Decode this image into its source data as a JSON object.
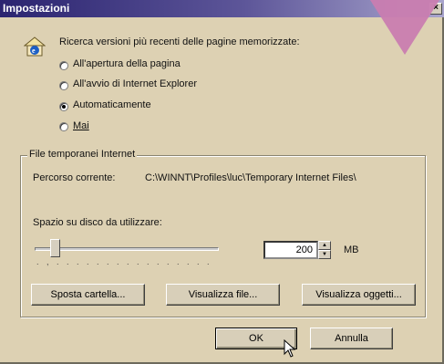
{
  "window": {
    "title": "Impostazioni",
    "close": "×"
  },
  "check": {
    "label": "Ricerca versioni più recenti delle pagine memorizzate:",
    "options": [
      {
        "label": "All'apertura della pagina",
        "selected": false
      },
      {
        "label": "All'avvio di Internet Explorer",
        "selected": false
      },
      {
        "label": "Automaticamente",
        "selected": true
      },
      {
        "label": "Mai",
        "selected": false
      }
    ]
  },
  "temp_files": {
    "group_label": "File temporanei Internet",
    "path_label": "Percorso corrente:",
    "path_value": "C:\\WINNT\\Profiles\\luc\\Temporary Internet Files\\",
    "disk_label": "Spazio su disco da utilizzare:",
    "disk_value": "200",
    "unit": "MB",
    "slider_level_fraction": 0.1,
    "ticks": ". , . . . . . . . . . . . . . . . ."
  },
  "buttons": {
    "move": "Sposta cartella...",
    "view_files": "Visualizza file...",
    "view_objects": "Visualizza oggetti...",
    "ok": "OK",
    "cancel": "Annulla"
  }
}
